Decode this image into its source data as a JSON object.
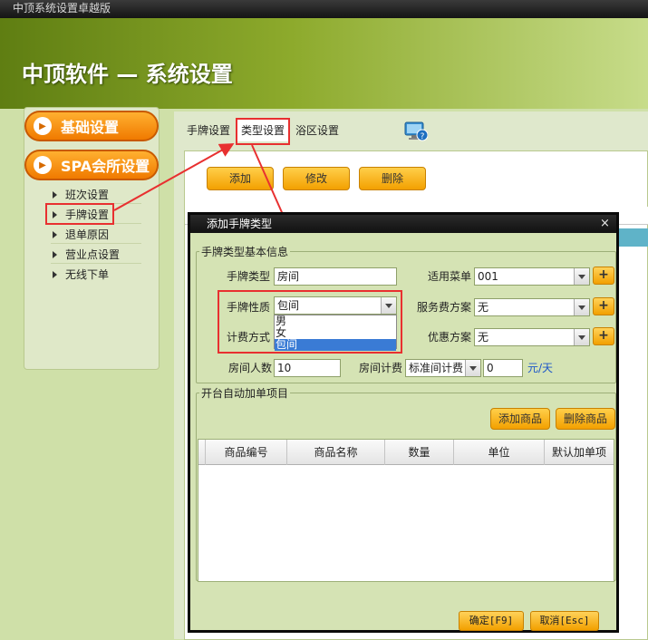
{
  "window": {
    "title": "中顶系统设置卓越版"
  },
  "banner": {
    "title": "中顶软件 — 系统设置"
  },
  "sidebar": {
    "sections": [
      {
        "label": "基础设置"
      },
      {
        "label": "SPA会所设置"
      }
    ],
    "items": [
      {
        "label": "班次设置"
      },
      {
        "label": "手牌设置"
      },
      {
        "label": "退单原因"
      },
      {
        "label": "营业点设置"
      },
      {
        "label": "无线下单"
      }
    ]
  },
  "tabs": [
    {
      "label": "手牌设置"
    },
    {
      "label": "类型设置"
    },
    {
      "label": "浴区设置"
    }
  ],
  "toolbar": {
    "add": "添加",
    "edit": "修改",
    "delete": "删除"
  },
  "dialog": {
    "title": "添加手牌类型",
    "close": "×",
    "basic_group": "手牌类型基本信息",
    "type_label": "手牌类型",
    "type_value": "房间",
    "menu_label": "适用菜单",
    "menu_value": "001",
    "nature_label": "手牌性质",
    "nature_value": "包间",
    "nature_options": [
      "男",
      "女",
      "包间"
    ],
    "service_label": "服务费方案",
    "service_value": "无",
    "billing_label": "计费方式",
    "discount_label": "优惠方案",
    "discount_value": "无",
    "people_label": "房间人数",
    "people_value": "10",
    "room_billing_label": "房间计费",
    "room_billing_value": "标准间计费",
    "price_value": "0",
    "price_unit": "元/天",
    "plus": "+",
    "auto_group": "开台自动加单项目",
    "add_goods": "添加商品",
    "delete_goods": "删除商品",
    "columns": [
      "商品编号",
      "商品名称",
      "数量",
      "单位",
      "默认加单项"
    ],
    "confirm": "确定[F9]",
    "cancel": "取消[Esc]"
  },
  "colors": {
    "accent": "#f3a000",
    "highlight": "#e83030",
    "dialog_bg": "#d5e3b4"
  }
}
